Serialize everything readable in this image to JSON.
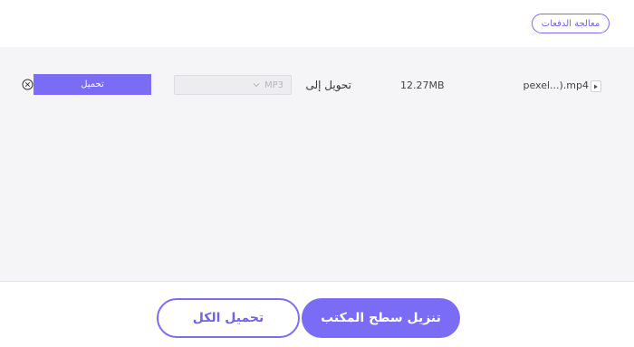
{
  "header": {
    "batch_label": "معالجة الدفعات"
  },
  "file_list": {
    "items": [
      {
        "name": "pexel...).mp4",
        "size": "12.27MB",
        "convert_to_label": "تحويل إلى",
        "format": "MP3",
        "convert_button_label": "تحميل",
        "file_icon": "video-file-icon",
        "remove_icon": "close-circle-icon"
      }
    ]
  },
  "footer": {
    "convert_all_label": "تحميل الكل",
    "download_desktop_label": "تنزيل سطح المكتب"
  },
  "colors": {
    "accent": "#7b6cf6",
    "list_background": "#f5f5f7"
  }
}
